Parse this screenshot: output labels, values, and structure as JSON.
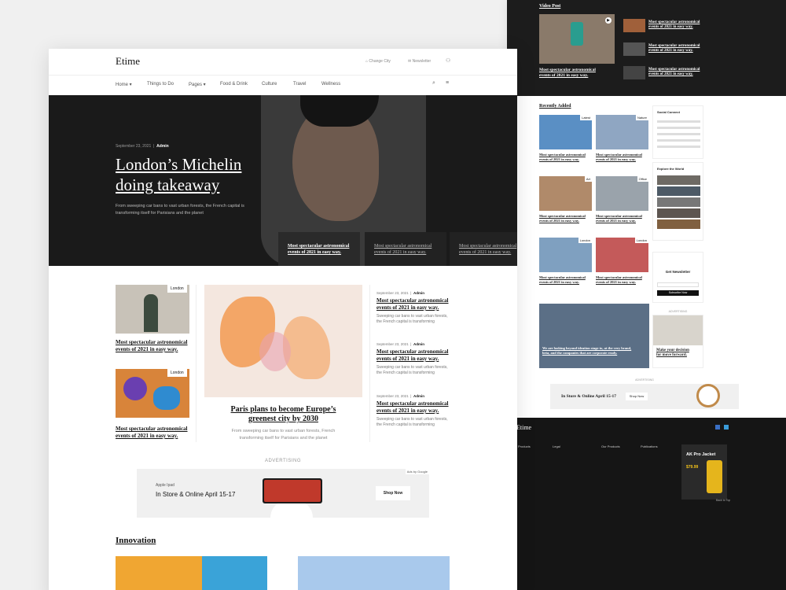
{
  "front": {
    "brand": "Etime",
    "top_links": {
      "change_city": "Change City",
      "newsletter": "Newsletter"
    },
    "nav": [
      "Home",
      "Things to Do",
      "Pages",
      "Food & Drink",
      "Culture",
      "Travel",
      "Wellness"
    ],
    "hero": {
      "date": "September 23, 2021",
      "author": "Admin",
      "title_line1": "London’s Michelin",
      "title_line2": "doing takeaway",
      "desc_line1": "From sweeping car bans to vast urban forests, the French capital is",
      "desc_line2": "transforming itself for Parisians and the planet",
      "strip": [
        {
          "l1": "Most spectacular astronomical",
          "l2": "events of 2021 in easy way."
        },
        {
          "l1": "Most spectacular astronomical",
          "l2": "events of 2021 in easy way."
        },
        {
          "l1": "Most spectacular astronomical",
          "l2": "events of 2021 in easy way."
        }
      ]
    },
    "left_cards": [
      {
        "badge": "London",
        "l1": "Most spectacular astronomical",
        "l2": "events of 2021 in easy way."
      },
      {
        "badge": "London",
        "l1": "Most spectacular astronomical",
        "l2": "events of 2021 in easy way."
      }
    ],
    "feature": {
      "l1": "Paris plans to become Europe’s",
      "l2": "greenest city by 2030",
      "d1": "From sweeping car bans to vast urban forests, French",
      "d2": "transforming itself for Parisians and the planet"
    },
    "side_list": [
      {
        "date": "September 23, 2021",
        "author": "Admin",
        "l1": "Most spectacular astronomical",
        "l2": "events of 2021 in easy way.",
        "d1": "Sweeping car bans to vast urban forests,",
        "d2": "the French capital is transforming"
      },
      {
        "date": "September 23, 2021",
        "author": "Admin",
        "l1": "Most spectacular astronomical",
        "l2": "events of 2021 in easy way.",
        "d1": "Sweeping car bans to vast urban forests,",
        "d2": "the French capital is transforming"
      },
      {
        "date": "September 23, 2021",
        "author": "Admin",
        "l1": "Most spectacular astronomical",
        "l2": "events of 2021 in easy way.",
        "d1": "Sweeping car bans to vast urban forests,",
        "d2": "the French capital is transforming"
      }
    ],
    "ad": {
      "label": "ADVERTISING",
      "small": "Apple Ipad",
      "headline": "In Store & Online April 15-17",
      "cta": "Shop Now",
      "google": "Ads by Google"
    },
    "section": "Innovation"
  },
  "back": {
    "video_label": "Video Post",
    "video_main_l1": "Most spectacular astronomical",
    "video_main_l2": "events of 2021 in easy way.",
    "video_list": [
      {
        "l1": "Most spectacular astronomical",
        "l2": "events of 2021 in easy way."
      },
      {
        "l1": "Most spectacular astronomical",
        "l2": "events of 2021 in easy way."
      },
      {
        "l1": "Most spectacular astronomical",
        "l2": "events of 2021 in easy way."
      }
    ],
    "recent_label": "Recently Added",
    "recent": [
      {
        "badge": "Latest",
        "l1": "Most spectacular astronomical",
        "l2": "events of 2021 in easy way."
      },
      {
        "badge": "Nature",
        "l1": "Most spectacular astronomical",
        "l2": "events of 2021 in easy way."
      },
      {
        "badge": "Art",
        "l1": "Most spectacular astronomical",
        "l2": "events of 2021 in easy way."
      },
      {
        "badge": "Office",
        "l1": "Most spectacular astronomical",
        "l2": "events of 2021 in easy way."
      },
      {
        "badge": "London",
        "l1": "Most spectacular astronomical",
        "l2": "events of 2021 in easy way."
      },
      {
        "badge": "London",
        "l1": "Most spectacular astronomical",
        "l2": "events of 2021 in easy way."
      }
    ],
    "wide_l1": "We are looking beyond ideation stage to, at the very brand,",
    "wide_l2": "beta, and the companies that are corporate ready.",
    "social_label": "Social Connect",
    "explore_label": "Explore the World",
    "newsletter_label": "Get Newsletter",
    "newsletter_btn": "Subscribe Now",
    "ad_small_label": "ADVERTISING",
    "decision_l1": "Make your decision",
    "decision_l2": "for move forward.",
    "ad2_label": "ADVERTISING",
    "ad2_headline": "In Store & Online April 15-17",
    "ad2_cta": "Shop Now",
    "footer_brand": "Etime",
    "footer_cols": [
      "Products",
      "Legal",
      "Our Products",
      "Publications"
    ],
    "promo_title": "AK Pro Jacket",
    "promo_price": "$79.99",
    "back_to_top": "Back to Top"
  }
}
